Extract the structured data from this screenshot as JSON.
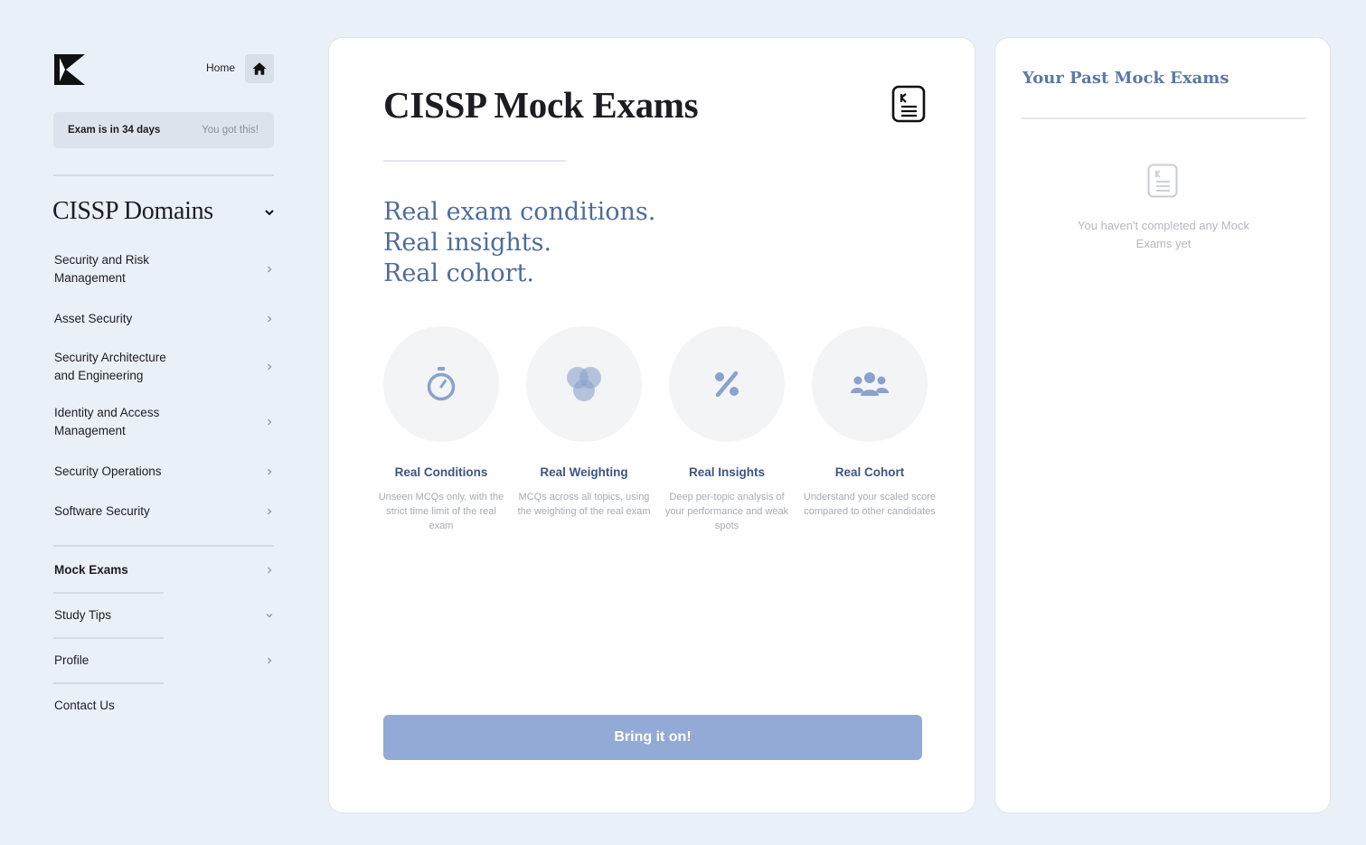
{
  "header": {
    "home_label": "Home"
  },
  "exam_banner": {
    "countdown": "Exam is in 34 days",
    "encouragement": "You got this!"
  },
  "sidebar": {
    "domains_title": "CISSP Domains",
    "domains": [
      {
        "label": "Security and Risk Management"
      },
      {
        "label": "Asset Security"
      },
      {
        "label": "Security Architecture and Engineering"
      },
      {
        "label": "Identity and Access Management"
      },
      {
        "label": "Security Operations"
      },
      {
        "label": "Software Security"
      }
    ],
    "nav": [
      {
        "label": "Mock Exams",
        "active": true
      },
      {
        "label": "Study Tips"
      },
      {
        "label": "Profile"
      },
      {
        "label": "Contact Us"
      }
    ]
  },
  "main": {
    "title": "CISSP Mock Exams",
    "tagline": [
      "Real exam conditions.",
      "Real insights.",
      "Real cohort."
    ],
    "features": [
      {
        "icon": "stopwatch-icon",
        "title": "Real Conditions",
        "description": "Unseen MCQs only, with the strict time limit of the real exam"
      },
      {
        "icon": "venn-diagram-icon",
        "title": "Real Weighting",
        "description": "MCQs across all topics, using the weighting of the real exam"
      },
      {
        "icon": "percent-icon",
        "title": "Real Insights",
        "description": "Deep per-topic analysis of your performance and weak spots"
      },
      {
        "icon": "users-group-icon",
        "title": "Real Cohort",
        "description": "Understand your scaled score compared to other candidates"
      }
    ],
    "cta_label": "Bring it on!"
  },
  "past_exams": {
    "title": "Your Past Mock Exams",
    "empty_message": "You haven't completed any Mock Exams yet"
  },
  "colors": {
    "background": "#eaf0f8",
    "accent": "#4f6c9a",
    "feature_title": "#3c5680",
    "cta": "#92aad5",
    "icon": "#8aa2cc"
  }
}
